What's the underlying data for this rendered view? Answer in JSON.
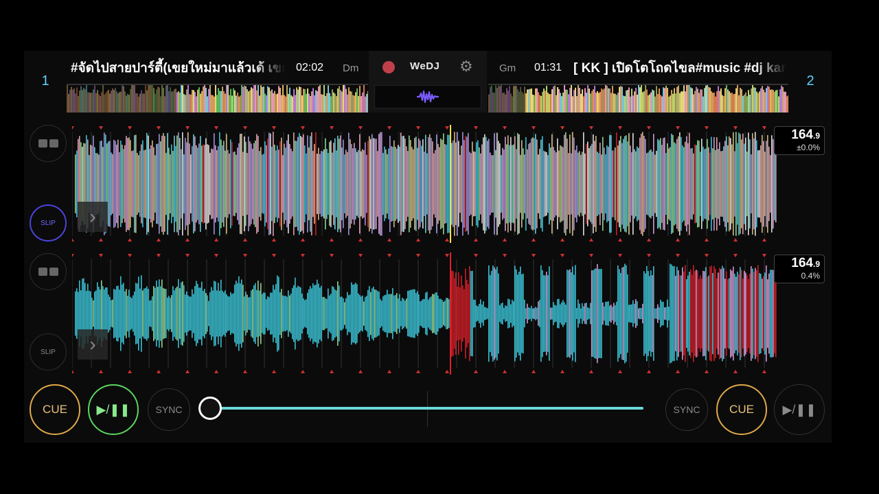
{
  "header": {
    "deck1": {
      "number": "1",
      "title": "#จัดไปสายปาร์ตี้(เขยใหม่มาแล้วเด้ เขยใหม่",
      "time": "02:02",
      "key": "Dm"
    },
    "deck2": {
      "number": "2",
      "title": "[ KK ] เปิดโตโถดไขล#music #dj karaoke",
      "time": "01:31",
      "key": "Gm"
    },
    "center": {
      "logo": "WeDJ",
      "record_icon": "record-icon",
      "settings_icon": "gear-icon",
      "waveform_icon": "waveform-icon"
    }
  },
  "decks": [
    {
      "bpm": "164",
      "bpm_decimal": ".9",
      "pitch": "±0.0%",
      "slip_label": "SLIP",
      "slip_active": true
    },
    {
      "bpm": "164",
      "bpm_decimal": ".9",
      "pitch": "0.4%",
      "slip_label": "SLIP",
      "slip_active": false
    }
  ],
  "controls": {
    "left_cue": "CUE",
    "left_play": "▶/❚❚",
    "left_sync": "SYNC",
    "right_sync": "SYNC",
    "right_cue": "CUE",
    "right_play": "▶/❚❚",
    "crossfader_position": 0
  },
  "colors": {
    "deck_number": "#5fd4ff",
    "cue": "#e0a94a",
    "play_active": "#5bd65e",
    "slip_active": "#4b43d9",
    "waveform_cyan": "#3fd3e8",
    "waveform_red": "#e0202a",
    "crossfader": "#6bd8d6"
  }
}
